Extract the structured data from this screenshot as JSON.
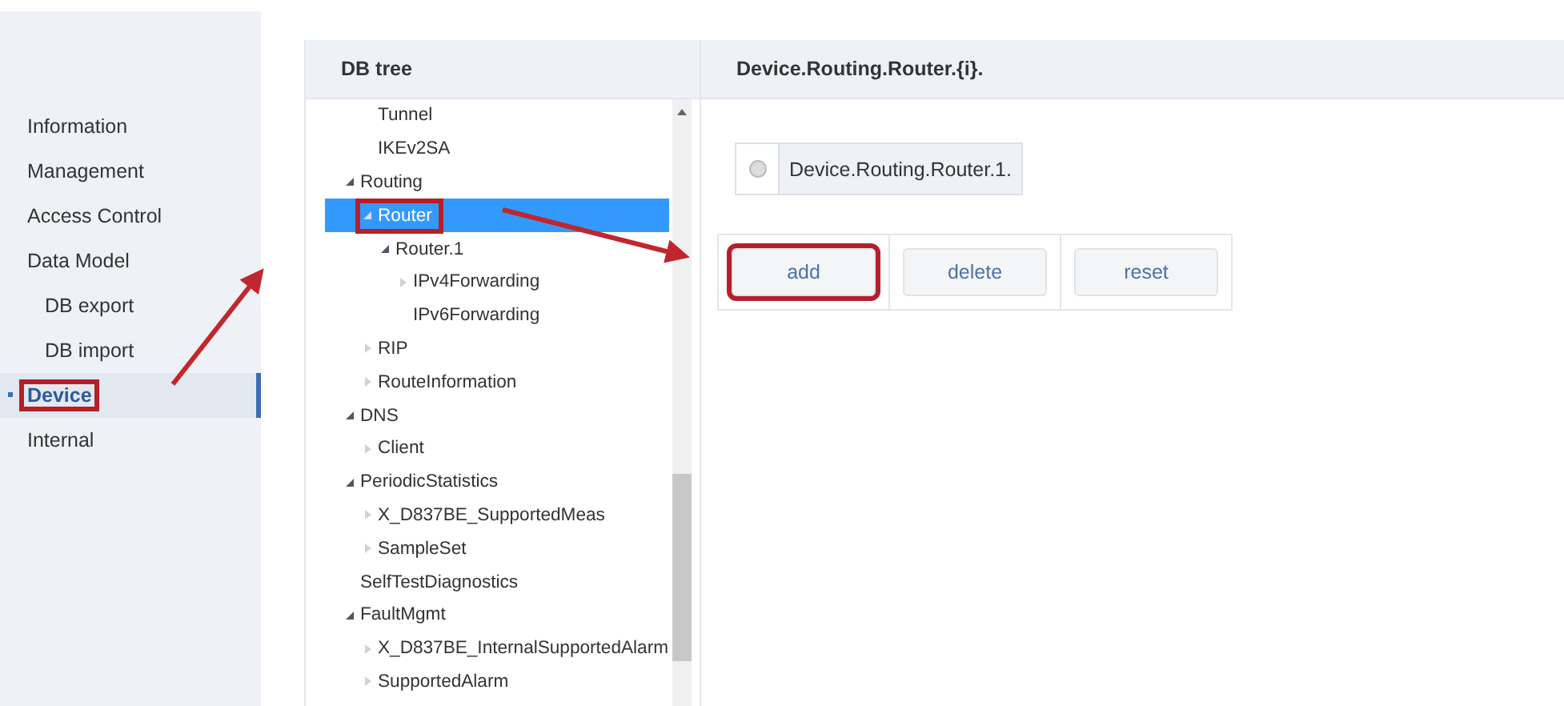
{
  "sidebar": {
    "items": [
      {
        "label": "Information",
        "sub": false,
        "selected": false,
        "highlighted": false
      },
      {
        "label": "Management",
        "sub": false,
        "selected": false,
        "highlighted": false
      },
      {
        "label": "Access Control",
        "sub": false,
        "selected": false,
        "highlighted": false
      },
      {
        "label": "Data Model",
        "sub": false,
        "selected": false,
        "highlighted": false
      },
      {
        "label": "DB export",
        "sub": true,
        "selected": false,
        "highlighted": false
      },
      {
        "label": "DB import",
        "sub": true,
        "selected": false,
        "highlighted": false
      },
      {
        "label": "Device",
        "sub": false,
        "selected": true,
        "highlighted": true
      },
      {
        "label": "Internal",
        "sub": false,
        "selected": false,
        "highlighted": false
      }
    ]
  },
  "tree": {
    "title": "DB tree",
    "nodes": [
      {
        "children": [
          {
            "label": "Tunnel",
            "selected": false,
            "highlighted": false
          },
          {
            "label": "IKEv2SA",
            "selected": false,
            "highlighted": false
          }
        ]
      },
      {
        "label": "Routing",
        "expanded": true,
        "selected": false,
        "highlighted": false,
        "children": [
          {
            "label": "Router",
            "expanded": true,
            "selected": true,
            "highlighted": true,
            "children": [
              {
                "label": "Router.1",
                "expanded": true,
                "selected": false,
                "highlighted": false,
                "children": [
                  {
                    "label": "IPv4Forwarding",
                    "expanded": false,
                    "selected": false,
                    "highlighted": false
                  },
                  {
                    "label": "IPv6Forwarding",
                    "selected": false,
                    "highlighted": false
                  }
                ]
              }
            ]
          },
          {
            "label": "RIP",
            "expanded": false,
            "selected": false,
            "highlighted": false
          },
          {
            "label": "RouteInformation",
            "expanded": false,
            "selected": false,
            "highlighted": false
          }
        ]
      },
      {
        "label": "DNS",
        "expanded": true,
        "selected": false,
        "highlighted": false,
        "children": [
          {
            "label": "Client",
            "expanded": false,
            "selected": false,
            "highlighted": false
          }
        ]
      },
      {
        "label": "PeriodicStatistics",
        "expanded": true,
        "selected": false,
        "highlighted": false,
        "children": [
          {
            "label": "X_D837BE_SupportedMeas",
            "expanded": false,
            "selected": false,
            "highlighted": false
          },
          {
            "label": "SampleSet",
            "expanded": false,
            "selected": false,
            "highlighted": false
          }
        ]
      },
      {
        "label": "SelfTestDiagnostics",
        "selected": false,
        "highlighted": false
      },
      {
        "label": "FaultMgmt",
        "expanded": true,
        "selected": false,
        "highlighted": false,
        "children": [
          {
            "label": "X_D837BE_InternalSupportedAlarm",
            "expanded": false,
            "selected": false,
            "highlighted": false
          },
          {
            "label": "SupportedAlarm",
            "expanded": false,
            "selected": false,
            "highlighted": false
          }
        ]
      }
    ]
  },
  "detail": {
    "title": "Device.Routing.Router.{i}.",
    "instances": [
      {
        "label": "Device.Routing.Router.1.",
        "selected": false
      }
    ],
    "buttons": [
      {
        "label": "add",
        "highlighted": true
      },
      {
        "label": "delete",
        "highlighted": false
      },
      {
        "label": "reset",
        "highlighted": false
      }
    ]
  }
}
